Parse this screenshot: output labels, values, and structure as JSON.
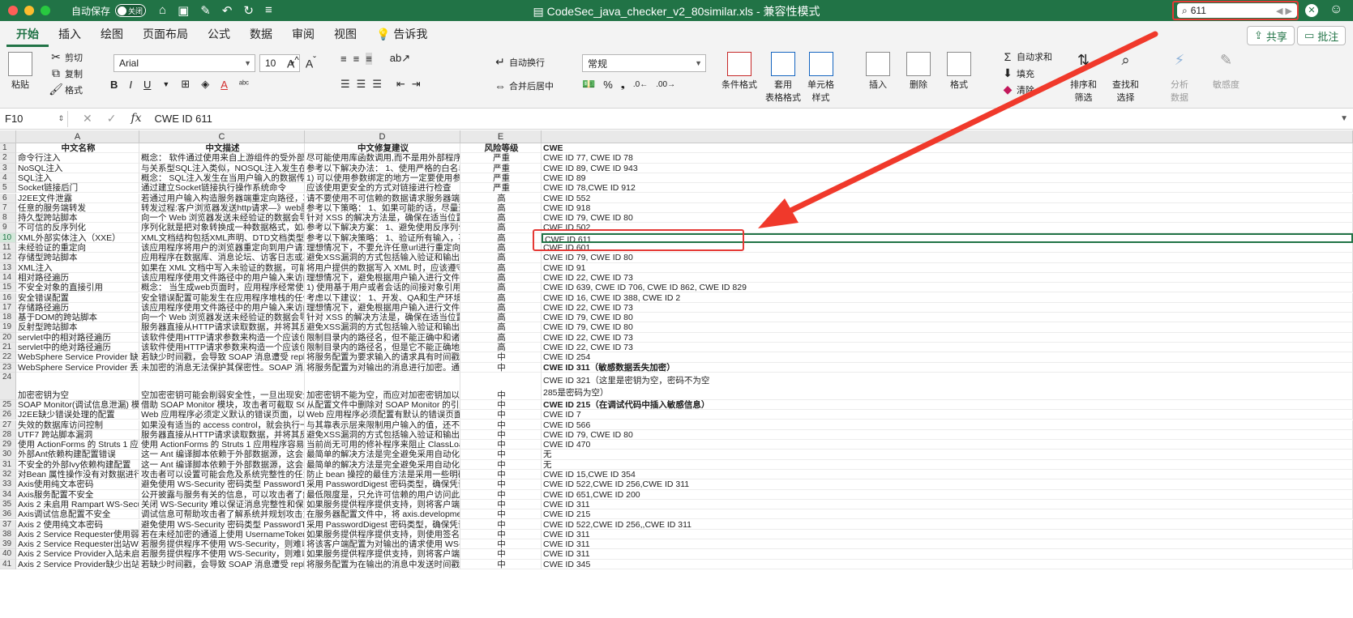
{
  "titlebar": {
    "autosave_label": "自动保存",
    "autosave_state": "关闭",
    "document_title": "CodeSec_java_checker_v2_80similar.xls",
    "mode": "兼容性模式",
    "search_value": "611"
  },
  "tabs": [
    "开始",
    "插入",
    "绘图",
    "页面布局",
    "公式",
    "数据",
    "审阅",
    "视图",
    "告诉我"
  ],
  "share_label": "共享",
  "comment_label": "批注",
  "ribbon": {
    "paste": "粘贴",
    "cut": "剪切",
    "copy": "复制",
    "format_painter": "格式",
    "font": "Arial",
    "size": "10",
    "wrap_text": "自动换行",
    "merge_center": "合并后居中",
    "number_format": "常规",
    "cond_format": "条件格式",
    "table_format_1": "套用",
    "table_format_2": "表格格式",
    "cell_style_1": "单元格",
    "cell_style_2": "样式",
    "insert": "插入",
    "delete": "删除",
    "format": "格式",
    "autosum": "自动求和",
    "fill": "填充",
    "clear": "清除",
    "sort_filter_1": "排序和",
    "sort_filter_2": "筛选",
    "find_select_1": "查找和",
    "find_select_2": "选择",
    "analyze_1": "分析",
    "analyze_2": "数据",
    "sensitivity": "敏感度"
  },
  "formula_bar": {
    "cell_ref": "F10",
    "value": "CWE ID 611"
  },
  "columns": [
    "A",
    "C",
    "D",
    "E"
  ],
  "rows": [
    {
      "n": "1",
      "a": "中文名称",
      "c": "中文描述",
      "d": "中文修复建议",
      "e": "风险等级",
      "f": "CWE",
      "hdr": true
    },
    {
      "n": "2",
      "a": "命令行注入",
      "c": "概念： 软件通过使用来自上游组件的受外部影响",
      "d": "尽可能使用库函数调用,而不是用外部程序来重",
      "e": "严重",
      "f": "CWE ID 77, CWE ID 78"
    },
    {
      "n": "3",
      "a": "NoSQL注入",
      "c": "与关系型SQL注入类似，NOSQL注入发生在当用",
      "d": "参考以下解决办法： 1、使用严格的白名单型",
      "e": "严重",
      "f": "CWE ID 89, CWE ID 943"
    },
    {
      "n": "4",
      "a": "SQL注入",
      "c": "概念： SQL注入发生在当用户输入的数据传送到S",
      "d": "1) 可以使用参数绑定的地方一定要使用参数绑",
      "e": "严重",
      "f": "CWE ID 89"
    },
    {
      "n": "5",
      "a": "Socket链接后门",
      "c": "通过建立Socket链接执行操作系统命令",
      "d": "应该使用更安全的方式对链接进行检查",
      "e": "严重",
      "f": "CWE ID 78,CWE ID 912"
    },
    {
      "n": "6",
      "a": "J2EE文件泄露",
      "c": "若通过用户输入构造服务器端重定向路径，攻击者",
      "d": "请不要使用不可信赖的数据请求服务器端资源",
      "e": "高",
      "f": "CWE ID 552"
    },
    {
      "n": "7",
      "a": "任意的服务端转发",
      "c": "转发过程:客户浏览器发送http请求—》web服务器",
      "d": "参考以下策略： 1、如果可能的话，尽量避免",
      "e": "高",
      "f": "CWE ID 918"
    },
    {
      "n": "8",
      "a": "持久型跨站脚本",
      "c": "向一个 Web 浏览器发送未经验证的数据会导致该",
      "d": "针对 XSS 的解决方法是，确保在适当位置进",
      "e": "高",
      "f": "CWE ID 79, CWE ID 80"
    },
    {
      "n": "9",
      "a": "不可信的反序列化",
      "c": "序列化就是把对象转换成一种数据格式，如Jso",
      "d": "参考以下解决方案： 1、避免使用反序列化是",
      "e": "高",
      "f": "CWE ID 502"
    },
    {
      "n": "10",
      "a": "XML外部实体注入（XXE）",
      "c": "XML文档结构包括XML声明、DTD文档类型定义（",
      "d": "参考以下解决策略： 1、验证所有输入，不管",
      "e": "高",
      "f": "CWE ID 611"
    },
    {
      "n": "11",
      "a": "未经验证的重定向",
      "c": "该应用程序将用户的浏览器重定向到用户请求中提",
      "d": "理想情况下，不要允许任意url进行重定向。相",
      "e": "高",
      "f": "CWE ID 601"
    },
    {
      "n": "12",
      "a": "存储型跨站脚本",
      "c": "应用程序在数据库、消息论坛、访客日志或其它可",
      "d": "避免XSS漏洞的方式包括输入验证和输出验证",
      "e": "高",
      "f": "CWE ID 79, CWE ID 80"
    },
    {
      "n": "13",
      "a": "XML注入",
      "c": "如果在 XML 文档中写入未验证的数据，可能会使",
      "d": "将用户提供的数据写入 XML 时，应该遵守以",
      "e": "高",
      "f": "CWE ID 91"
    },
    {
      "n": "14",
      "a": "相对路径遍历",
      "c": "该应用程序使用文件路径中的用户输入来访问应用",
      "d": "理想情况下，避免根据用户输入进行文件选择",
      "e": "高",
      "f": "CWE ID 22, CWE ID 73"
    },
    {
      "n": "15",
      "a": "不安全对象的直接引用",
      "c": "概念： 当生成web页面时，应用程序经常使用对象",
      "d": "1) 使用基于用户或者会话的间接对象引用。这",
      "e": "高",
      "f": "CWE ID 639, CWE ID 706, CWE ID 862, CWE ID 829"
    },
    {
      "n": "16",
      "a": "安全错误配置",
      "c": "安全错误配置可能发生在应用程序堆栈的任何级别",
      "d": "考虑以下建议： 1、开发、QA和生产环境都",
      "e": "高",
      "f": "CWE ID 16, CWE ID 388, CWE ID 2"
    },
    {
      "n": "17",
      "a": "存储路径遍历",
      "c": "该应用程序使用文件路径中的用户输入来访问应用",
      "d": "理想情况下，避免根据用户输入进行文件选择",
      "e": "高",
      "f": "CWE ID 22, CWE ID 73"
    },
    {
      "n": "18",
      "a": "基于DOM的跨站脚本",
      "c": "向一个 Web 浏览器发送未经验证的数据会导致该",
      "d": "针对 XSS 的解决方法是，确保在适当位置进",
      "e": "高",
      "f": "CWE ID 79, CWE ID 80"
    },
    {
      "n": "19",
      "a": "反射型跨站脚本",
      "c": "服务器直接从HTTP请求读取数据，并将其反射在",
      "d": "避免XSS漏洞的方式包括输入验证和输出验证",
      "e": "高",
      "f": "CWE ID 79, CWE ID 80"
    },
    {
      "n": "20",
      "a": "servlet中的相对路径遍历",
      "c": "该软件使用HTTP请求参数来构造一个应该位于受",
      "d": "限制目录内的路径名，但不能正确中和诸如\"..",
      "e": "高",
      "f": "CWE ID 22, CWE ID 73"
    },
    {
      "n": "21",
      "a": "servlet中的绝对路径遍历",
      "c": "该软件使用HTTP请求参数来构造一个应该位于受",
      "d": "限制目录内的路径名，但是它不能正确地中和",
      "e": "高",
      "f": "CWE ID 22, CWE ID 73"
    },
    {
      "n": "22",
      "a": "WebSphere Service Provider 缺少",
      "c": "若缺少时间戳，会导致 SOAP 消息遭受 replay 攻",
      "d": "将服务配置为要求输入的请求具有时间戳。",
      "e": "中",
      "f": "CWE ID 254"
    },
    {
      "n": "23",
      "a": "WebSphere Service Provider 丢失",
      "c": "未加密的消息无法保护其保密性。SOAP 消息级",
      "d": "将服务配置为对输出的消息进行加密。通过启",
      "e": "中",
      "f": "CWE ID 311（敏感数据丢失加密）",
      "fbold": true
    },
    {
      "n": "24",
      "a": "加密密钥为空",
      "c": "空加密密钥可能会削弱安全性，一旦出现安全问题",
      "d": "加密密钥不能为空，而应对加密密钥加以模糊",
      "e": "中",
      "f": "CWE ID 321（这里是密钥为空，密码不为空",
      "f2": "285是密码为空）",
      "tall": true
    },
    {
      "n": "25",
      "a": "SOAP Monitor(调试信息泄漏) 模块",
      "c": "借助 SOAP Monitor 模块，攻击者可截取 SOAP",
      "d": "从配置文件中删除对 SOAP Monitor 的引用。",
      "e": "中",
      "f": "CWE ID 215（在调试代码中插入敏感信息）",
      "fbold": true
    },
    {
      "n": "26",
      "a": "J2EE缺少错误处理的配置",
      "c": "Web 应用程序必须定义默认的错误页面，以避免",
      "d": "Web 应用程序必须配置有默认的错误页面。",
      "e": "中",
      "f": "CWE ID 7"
    },
    {
      "n": "27",
      "a": "失效的数据库访问控制",
      "c": "如果没有适当的 access control，就会执行一个包",
      "d": "与其靠表示层来限制用户输入的值，还不如在",
      "e": "中",
      "f": "CWE ID 566"
    },
    {
      "n": "28",
      "a": "UTF7 跨站脚本漏洞",
      "c": "服务器直接从HTTP请求读取数据，并将其反射在",
      "d": "避免XSS漏洞的方式包括输入验证和输出验证",
      "e": "中",
      "f": "CWE ID 79, CWE ID 80"
    },
    {
      "n": "29",
      "a": "使用 ActionForms 的 Struts 1 应用",
      "c": "使用 ActionForms 的 Struts 1 应用程序容易遭到",
      "d": "当前尚无可用的修补程序来阻止 ClassLoade",
      "e": "中",
      "f": "CWE ID 470"
    },
    {
      "n": "30",
      "a": "外部Ant依赖构建配置错误",
      "c": "这一 Ant 编译脚本依赖于外部数据源，这会导致",
      "d": "最简单的解决方法是完全避免采用自动化 dep",
      "e": "中",
      "f": "无"
    },
    {
      "n": "31",
      "a": "不安全的外部Ivy依赖构建配置",
      "c": "这一 Ant 编译脚本依赖于外部数据源，这会导致",
      "d": "最简单的解决方法是完全避免采用自动化 dep",
      "e": "中",
      "f": "无"
    },
    {
      "n": "32",
      "a": "对Bean 属性操作没有对数据进行验",
      "c": "攻击者可以设置可能会危及系统完整性的任意 bea",
      "d": "防止 bean 操控的最佳方法是采用一些明确手",
      "e": "中",
      "f": "CWE ID 15,CWE ID 354"
    },
    {
      "n": "33",
      "a": "Axis使用纯文本密码",
      "c": "避免使用 WS-Security 密码类型 PasswordText。",
      "d": "采用 PasswordDigest 密码类型，确保凭证在",
      "e": "中",
      "f": "CWE ID 522,CWE ID 256,CWE ID 311"
    },
    {
      "n": "34",
      "a": "Axis服务配置不安全",
      "c": "公开披露与服务有关的信息，可以攻击者了解如",
      "d": "最低限度是，只允许可信赖的用户访问此服务",
      "e": "中",
      "f": "CWE ID 651,CWE ID 200"
    },
    {
      "n": "35",
      "a": "Axis 2 未启用 Rampart WS-Security",
      "c": "关闭 WS-Security 难以保证消息完整性和保密性",
      "d": "如果服务提供程序提供支持，则将客户端配置",
      "e": "中",
      "f": "CWE ID 311"
    },
    {
      "n": "36",
      "a": "Axis调试信息配置不安全",
      "c": "调试信息可帮助攻击者了解系统并规划攻击方式。",
      "d": "在服务器配置文件中，将 axis.development.",
      "e": "中",
      "f": "CWE ID 215"
    },
    {
      "n": "37",
      "a": "Axis 2 使用纯文本密码",
      "c": "避免使用 WS-Security 密码类型 PasswordText。",
      "d": "采用 PasswordDigest 密码类型，确保凭证在",
      "e": "中",
      "f": "CWE ID 522,CWE ID 256,,CWE ID 311"
    },
    {
      "n": "38",
      "a": "Axis 2 Service Requester使用弱令",
      "c": "若在未经加密的通道上使用 UsernameToken 及其",
      "d": "如果服务提供程序提供支持，则使用签名代替",
      "e": "中",
      "f": "CWE ID 311"
    },
    {
      "n": "39",
      "a": "Axis 2 Service Requester出站WS-S",
      "c": "若服务提供程序不使用 WS-Security，则难以保证",
      "d": "将该客户端配置为对输出的请求使用 WS-Sec",
      "e": "中",
      "f": "CWE ID 311"
    },
    {
      "n": "40",
      "a": "Axis 2 Service Provider入站未启用",
      "c": "若服务提供程序不使用 WS-Security，则难以保证",
      "d": "如果服务提供程序提供支持，则将客户端配置",
      "e": "中",
      "f": "CWE ID 311"
    },
    {
      "n": "41",
      "a": "Axis 2 Service Provider缺少出站时",
      "c": "若缺少时间戳，会导致 SOAP 消息遭受 replay 攻",
      "d": "将服务配置为在输出的消息中发送时间戳。",
      "e": "中",
      "f": "CWE ID 345"
    }
  ]
}
